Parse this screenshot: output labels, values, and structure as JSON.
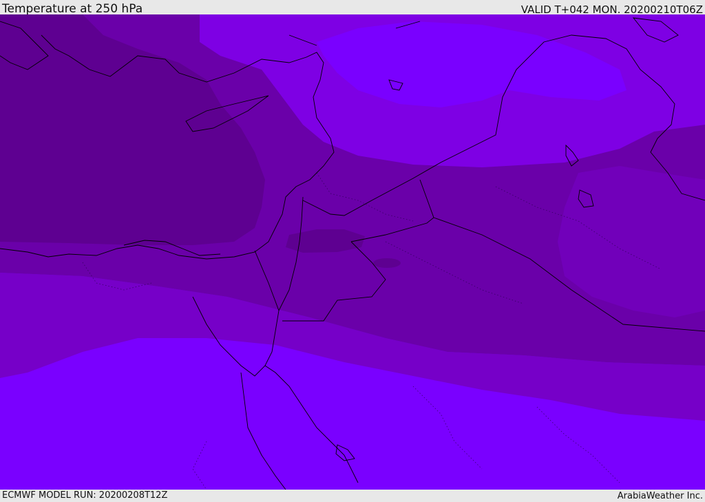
{
  "header": {
    "title": "Temperature at 250 hPa",
    "valid": "VALID T+042 MON. 20200210T06Z"
  },
  "footer": {
    "model_run": "ECMWF MODEL RUN: 20200208T12Z",
    "credit": "ArabiaWeather Inc."
  },
  "colors": {
    "band_coldest": "#5e0091",
    "band_cold": "#6a00a9",
    "band_mid": "#7600c8",
    "band_warm": "#7e00e4",
    "band_warmest": "#7a00ff",
    "coastline": "#000000"
  }
}
